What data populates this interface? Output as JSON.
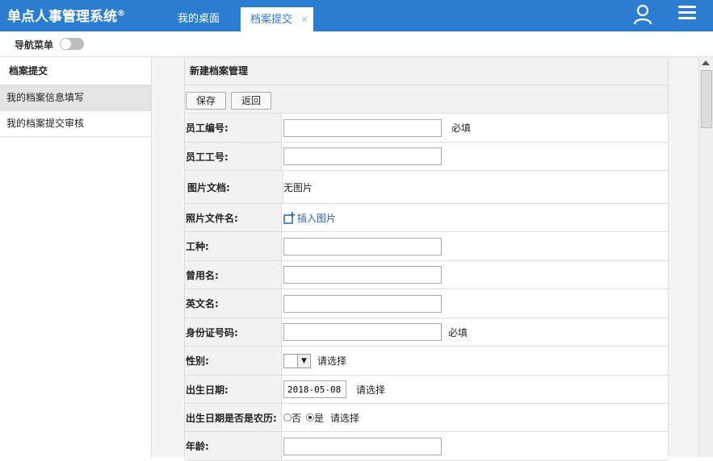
{
  "header": {
    "app_title": "单点人事管理系统",
    "registered": "®",
    "tabs": [
      {
        "label": "我的桌面"
      },
      {
        "label": "档案提交",
        "close": "×"
      }
    ]
  },
  "navbar": {
    "label": "导航菜单"
  },
  "sidebar": {
    "title": "档案提交",
    "items": [
      {
        "label": "我的档案信息填写"
      },
      {
        "label": "我的档案提交审核"
      }
    ]
  },
  "form": {
    "title": "新建档案管理",
    "buttons": {
      "save": "保存",
      "back": "返回"
    },
    "fields": {
      "employee_no": {
        "label": "员工编号:",
        "note": "必填"
      },
      "employee_id": {
        "label": "员工工号:"
      },
      "photo_doc": {
        "label": "图片文档:",
        "value": "无图片"
      },
      "photo_file": {
        "label": "照片文件名:",
        "link": "插入图片"
      },
      "job_type": {
        "label": "工种:"
      },
      "former_name": {
        "label": "曾用名:"
      },
      "english_name": {
        "label": "英文名:"
      },
      "id_number": {
        "label": "身份证号码:",
        "note": "必填"
      },
      "gender": {
        "label": "性别:",
        "note": "请选择"
      },
      "birth_date": {
        "label": "出生日期:",
        "value": "2018-05-08",
        "note": "请选择"
      },
      "lunar": {
        "label": "出生日期是否是农历:",
        "option_no": "否",
        "option_yes": "是",
        "note": "请选择"
      },
      "age": {
        "label": "年龄:"
      }
    }
  },
  "colors": {
    "header": "#2b7dd1",
    "link": "#2563b8"
  }
}
